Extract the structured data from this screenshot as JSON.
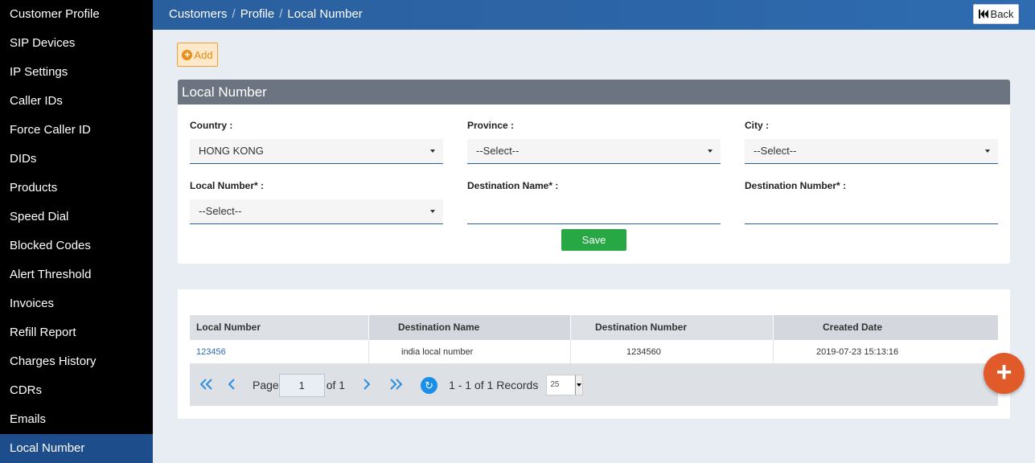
{
  "sidebar": {
    "items": [
      {
        "label": "Customer Profile"
      },
      {
        "label": "SIP Devices"
      },
      {
        "label": "IP Settings"
      },
      {
        "label": "Caller IDs"
      },
      {
        "label": "Force Caller ID"
      },
      {
        "label": "DIDs"
      },
      {
        "label": "Products"
      },
      {
        "label": "Speed Dial"
      },
      {
        "label": "Blocked Codes"
      },
      {
        "label": "Alert Threshold"
      },
      {
        "label": "Invoices"
      },
      {
        "label": "Refill Report"
      },
      {
        "label": "Charges History"
      },
      {
        "label": "CDRs"
      },
      {
        "label": "Emails"
      },
      {
        "label": "Local Number"
      }
    ],
    "active_index": 15
  },
  "header": {
    "breadcrumb": [
      "Customers",
      "Profile",
      "Local Number"
    ],
    "separator": "/",
    "back_label": "Back"
  },
  "actions": {
    "add_label": "Add"
  },
  "form": {
    "title": "Local Number",
    "country_label": "Country :",
    "country_value": "HONG KONG",
    "province_label": "Province :",
    "province_value": "--Select--",
    "city_label": "City :",
    "city_value": "--Select--",
    "local_number_label": "Local Number* :",
    "local_number_value": "--Select--",
    "destination_name_label": "Destination Name* :",
    "destination_name_value": "",
    "destination_number_label": "Destination Number* :",
    "destination_number_value": "",
    "save_label": "Save"
  },
  "table": {
    "columns": [
      "Local Number",
      "Destination Name",
      "Destination Number",
      "Created Date"
    ],
    "rows": [
      [
        "123456",
        "india local number",
        "1234560",
        "2019-07-23 15:13:16"
      ]
    ]
  },
  "pager": {
    "page_label": "Page",
    "page_value": "1",
    "of_label": "of 1",
    "records_label": "1 - 1 of 1 Records",
    "rows_per_page": "25"
  },
  "colors": {
    "sidebar_bg": "#000000",
    "sidebar_active": "#1e4d8c",
    "header_bg": "#2a5f9e",
    "save_green": "#28a745",
    "fab_orange": "#e15a2a",
    "add_orange": "#e8901a"
  },
  "icons": {
    "back": "skip-back-icon",
    "add": "plus-circle-icon",
    "first": "double-chevron-left-icon",
    "prev": "chevron-left-icon",
    "next": "chevron-right-icon",
    "last": "double-chevron-right-icon",
    "refresh": "refresh-icon",
    "fab": "plus-icon"
  }
}
